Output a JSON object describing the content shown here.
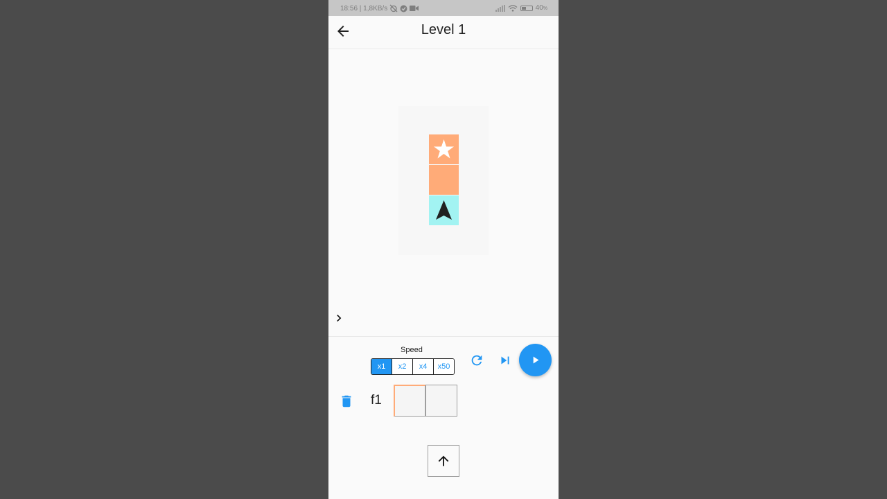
{
  "status_bar": {
    "left_text": "18:56 | 1,8KB/s",
    "battery_text": "40",
    "battery_fraction": 0.4
  },
  "app_bar": {
    "title": "Level 1",
    "back_icon": "arrow-back-icon"
  },
  "board": {
    "cells": [
      {
        "type": "goal",
        "color": "#ffab78",
        "icon": "star-icon"
      },
      {
        "type": "path",
        "color": "#ffab78"
      },
      {
        "type": "start",
        "color": "#a2f3f2",
        "icon": "navigation-arrow-icon",
        "direction": "up"
      }
    ]
  },
  "controls": {
    "speed_label": "Speed",
    "speed_options": [
      "x1",
      "x2",
      "x4",
      "x50"
    ],
    "selected_speed": "x1",
    "reset_icon": "refresh-icon",
    "step_icon": "skip-next-icon",
    "play_icon": "play-icon",
    "accent_color": "#2196f3"
  },
  "program": {
    "function_label": "f1",
    "slot_count": 2,
    "delete_icon": "trash-icon"
  },
  "commands": [
    {
      "name": "forward",
      "icon": "arrow-up-icon"
    }
  ]
}
